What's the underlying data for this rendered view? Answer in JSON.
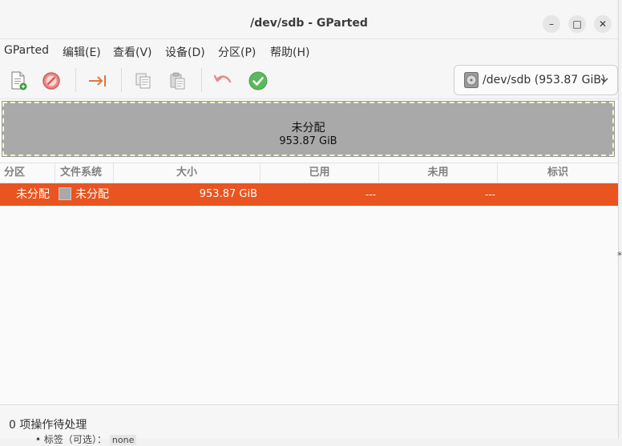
{
  "window": {
    "title": "/dev/sdb - GParted",
    "minimize_glyph": "–",
    "maximize_glyph": "□",
    "close_glyph": "✕"
  },
  "menu": {
    "items": [
      {
        "label": "GParted"
      },
      {
        "label": "编辑(E)"
      },
      {
        "label": "查看(V)"
      },
      {
        "label": "设备(D)"
      },
      {
        "label": "分区(P)"
      },
      {
        "label": "帮助(H)"
      }
    ]
  },
  "toolbar": {
    "icons": [
      "new-partition-icon",
      "delete-icon",
      "resize-move-icon",
      "copy-icon",
      "paste-icon",
      "undo-icon",
      "apply-icon"
    ],
    "device_selector": {
      "value": "/dev/sdb (953.87 GiB)",
      "icon": "disk-icon"
    }
  },
  "graph": {
    "name": "未分配",
    "size": "953.87 GiB"
  },
  "table": {
    "headers": [
      "分区",
      "文件系统",
      "大小",
      "已用",
      "未用",
      "标识"
    ],
    "rows": [
      {
        "partition": "未分配",
        "filesystem": "未分配",
        "size": "953.87 GiB",
        "used": "---",
        "unused": "---",
        "flags": ""
      }
    ]
  },
  "status": {
    "text": "0 项操作待处理"
  },
  "background": {
    "peek_text": "• 标签（可选）：",
    "peek_code": "none",
    "right_peek": "*"
  },
  "colors": {
    "accent": "#e95420",
    "unallocated": "#a9a9a9",
    "apply_green": "#4caf50",
    "delete_red": "#e06666"
  }
}
